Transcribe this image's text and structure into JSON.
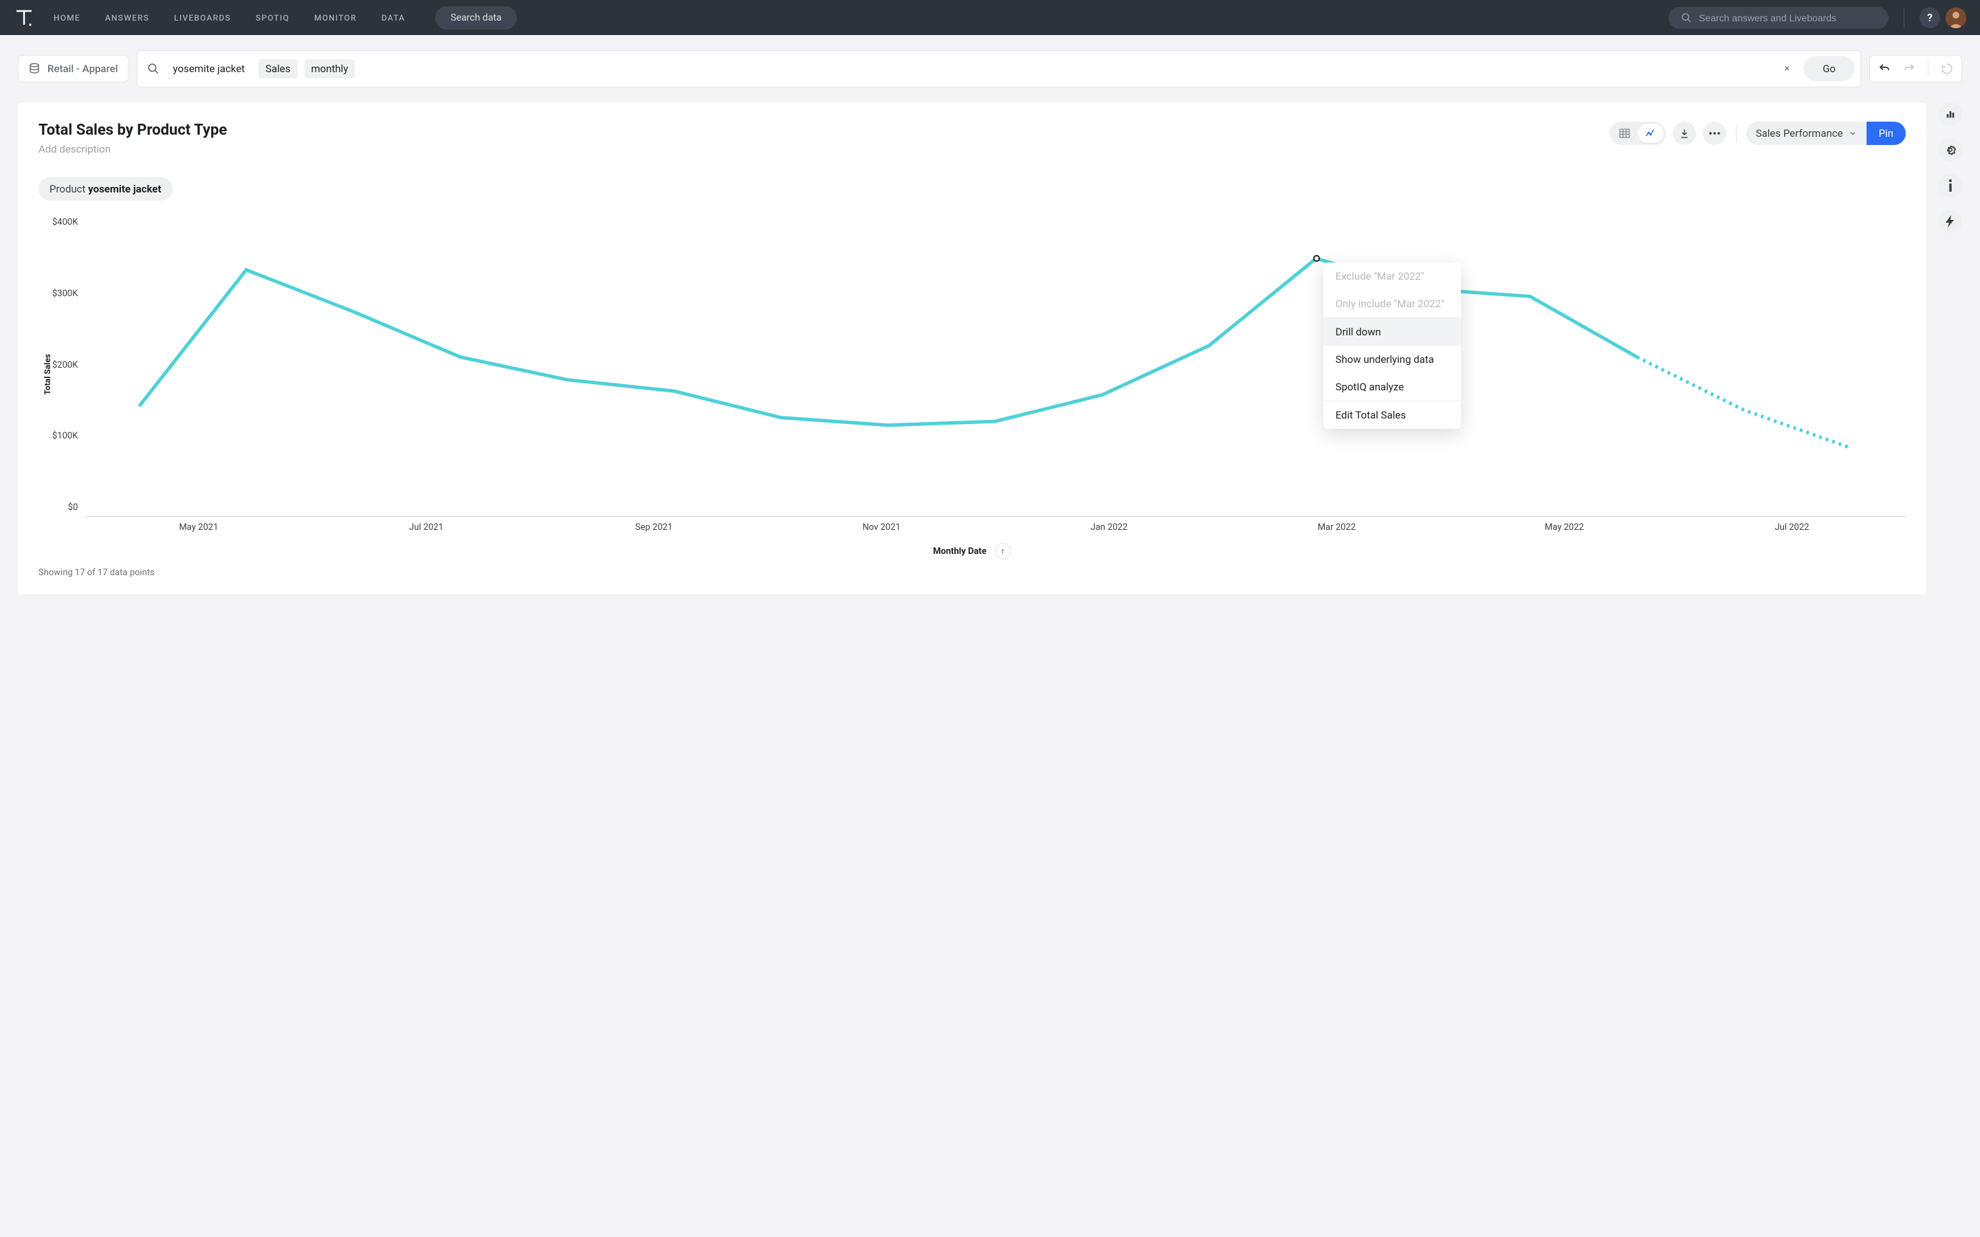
{
  "nav": {
    "links": [
      "HOME",
      "ANSWERS",
      "LIVEBOARDS",
      "SPOTIQ",
      "MONITOR",
      "DATA"
    ],
    "search_data_label": "Search data",
    "global_search_placeholder": "Search answers and Liveboards",
    "help_label": "?"
  },
  "toolbar": {
    "datasource_label": "Retail - Apparel",
    "tokens": [
      "yosemite jacket",
      "Sales",
      "monthly"
    ],
    "go_label": "Go",
    "clear_label": "×"
  },
  "canvas": {
    "title": "Total Sales by Product Type",
    "description_placeholder": "Add description",
    "filter_prefix": "Product ",
    "filter_value": "yosemite jacket",
    "liveboard_dropdown": "Sales Performance",
    "pin_label": "Pin",
    "datapoints_text": "Showing 17 of 17 data points",
    "x_axis_label": "Monthly Date",
    "y_axis_label": "Total Sales",
    "y_ticks": [
      "$400K",
      "$300K",
      "$200K",
      "$100K",
      "$0"
    ],
    "x_ticks": [
      "May 2021",
      "Jul 2021",
      "Sep 2021",
      "Nov 2021",
      "Jan 2022",
      "Mar 2022",
      "May 2022",
      "Jul 2022"
    ]
  },
  "context_menu": {
    "items": [
      {
        "label": "Exclude \"Mar 2022\"",
        "disabled": true
      },
      {
        "label": "Only include \"Mar 2022\"",
        "disabled": true
      },
      {
        "label": "Drill down",
        "hover": true
      },
      {
        "label": "Show underlying data"
      },
      {
        "label": "SpotIQ analyze"
      },
      {
        "label": "Edit Total Sales"
      }
    ],
    "sep_after": [
      1,
      4
    ]
  },
  "chart_data": {
    "type": "line",
    "title": "Total Sales by Product Type",
    "xlabel": "Monthly Date",
    "ylabel": "Total Sales",
    "ylim": [
      0,
      400000
    ],
    "series": [
      {
        "name": "yosemite jacket",
        "x": [
          "Apr 2021",
          "May 2021",
          "Jun 2021",
          "Jul 2021",
          "Aug 2021",
          "Sep 2021",
          "Oct 2021",
          "Nov 2021",
          "Dec 2021",
          "Jan 2022",
          "Feb 2022",
          "Mar 2022",
          "Apr 2022",
          "May 2022",
          "Jun 2022",
          "Jul 2022",
          "Aug 2022"
        ],
        "y": [
          145000,
          325000,
          270000,
          210000,
          180000,
          165000,
          130000,
          120000,
          125000,
          160000,
          225000,
          340000,
          300000,
          290000,
          210000,
          140000,
          90000
        ]
      }
    ],
    "forecast_start_index": 14
  }
}
